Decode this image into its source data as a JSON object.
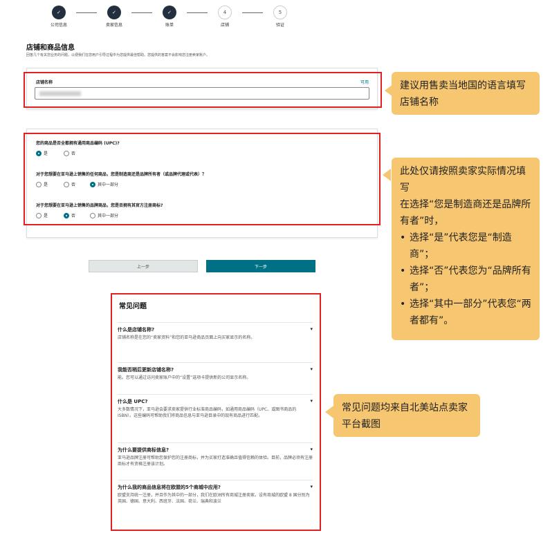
{
  "steps": [
    {
      "num": "✓",
      "label": "公司信息",
      "done": true
    },
    {
      "num": "✓",
      "label": "卖家信息",
      "done": true
    },
    {
      "num": "✓",
      "label": "账单",
      "done": true
    },
    {
      "num": "4",
      "label": "店铺",
      "done": false
    },
    {
      "num": "5",
      "label": "验证",
      "done": false
    }
  ],
  "section": {
    "title": "店铺和商品信息",
    "subtitle": "回答几个有关您业务的问题，以便我们在您用户引导过程中为您提供最佳帮助。您提供的答案不会影响您注册卖家账户。"
  },
  "store_name": {
    "label": "店铺名称",
    "link": "可用",
    "value": ""
  },
  "questions": [
    {
      "text": "您的商品是否全都拥有通用商品编码 (UPC)?",
      "options": [
        "是",
        "否"
      ],
      "selected": 0
    },
    {
      "text": "对于您想要在亚马逊上销售的任何商品，您是制造商还是品牌所有者（或品牌代理或代表）？",
      "options": [
        "是",
        "否",
        "其中一部分"
      ],
      "selected": 2
    },
    {
      "text": "对于您想要在亚马逊上销售的品牌商品，您是否拥有其官方注册商标?",
      "options": [
        "是",
        "否",
        "其中一部分"
      ],
      "selected": 1
    }
  ],
  "buttons": {
    "prev": "上一步",
    "next": "下一步"
  },
  "callouts": {
    "c1": "建议用售卖当地国的语言填写店铺名称",
    "c2_intro": "此处仅请按照卖家实际情况填写",
    "c2_line2": "在选择“您是制造商还是品牌所有者”时，",
    "c2_items": [
      "选择“是”代表您是“制造商”；",
      "选择“否”代表您为“品牌所有者”；",
      "选择“其中一部分”代表您“两者都有”。"
    ],
    "c3": "常见问题均来自北美站点卖家平台截图"
  },
  "faq": {
    "title": "常见问题",
    "items": [
      {
        "q": "什么是店铺名称?",
        "a": "店铺名称是在您的“卖家资料”和您的亚马逊商品页面上向买家显示的名称。"
      },
      {
        "q": "我能否稍后更新店铺名称?",
        "a": "能。您可以通过访问卖家账户中的“设置”选项卡提供新的公司显示名称。"
      },
      {
        "q": "什么是 UPC?",
        "a": "大多数情况下，亚马逊会要求卖家提供行业标准商品编码，如通用商品编码（UPC、或图书商品的 ISBN）。这些编码可帮助我们将商品信息与亚马逊目录中的现有商品进行匹配。"
      },
      {
        "q": "为什么要提供商标信息?",
        "a": "亚马逊品牌注册可帮助您保护您的注册商标，并为买家打造准确且值得信赖的体验。目前，品牌必须有注册商标才有资格注册该计划。"
      },
      {
        "q": "为什么我的商品信息将在欧盟的5个商城中应用?",
        "a": "欧盟支持统一注册，并且作为其中的一部分，我们在欧洲所有商城注册卖家。设有商城的欧盟 8 国分别为英国、德国、意大利、西班牙、法国、荷兰、瑞典和波兰"
      }
    ]
  },
  "colors": {
    "accent": "#007185",
    "navy": "#232f3e",
    "highlight": "#e02020",
    "callout": "#f6c670"
  }
}
